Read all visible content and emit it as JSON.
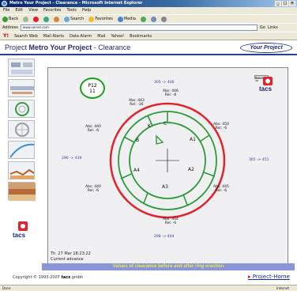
{
  "window": {
    "title": "Metro Your Project - Clearance - Microsoft Internet Explorer"
  },
  "menu": [
    "File",
    "Edit",
    "View",
    "Favorites",
    "Tools",
    "Help"
  ],
  "toolbar": {
    "back": "Back",
    "search": "Search",
    "favorites": "Favorites",
    "media": "Media"
  },
  "address": {
    "label": "Address",
    "value": "www.server.com",
    "go": "Go",
    "links": "Links"
  },
  "linksbar": {
    "logo": "Y!",
    "search_web": "Search Web",
    "items": [
      "Mail Alerts",
      "Data Alarm",
      "Mail",
      "Yahoo!",
      "Bookmarks"
    ]
  },
  "header": {
    "prefix": "Project",
    "project": "Metro Your Project",
    "suffix": "- Clearance",
    "logo": "Your Project"
  },
  "badge": {
    "line1": "P12",
    "line2": "11"
  },
  "tacs": {
    "button": "Back to list",
    "logo": "tacs"
  },
  "sidebar_logo": "tacs",
  "ring": {
    "segments": [
      "C",
      "A1",
      "A2",
      "A3",
      "A4",
      "B",
      "K"
    ],
    "measurements": {
      "top": "305 -> 446",
      "left": "296 -> 439",
      "right": "365 -> 451",
      "bottom": "298 -> 444"
    },
    "readings": [
      {
        "abs": "Abs: 443",
        "rel": "Rel: -16"
      },
      {
        "abs": "Abs: 446",
        "rel": "Rel: -8"
      },
      {
        "abs": "Abs: 450",
        "rel": "Rel: -6"
      },
      {
        "abs": "Abs: 440",
        "rel": "Rel: -6"
      },
      {
        "abs": "Abs: 440",
        "rel": "Rel: -6"
      },
      {
        "abs": "Abs: 445",
        "rel": "Rel: -6"
      },
      {
        "abs": "Abs: 444",
        "rel": "Rel: -6"
      }
    ]
  },
  "info": {
    "datetime": "Th. 27 Mar      18:23:22",
    "status": "Current advance"
  },
  "caption": "Values of clearance before and after ring erection",
  "copyright": {
    "text": "Copyright © 1993-2007",
    "brand": "tacs",
    "suffix": "gmbh"
  },
  "project_home": "Project-Home",
  "status": {
    "left": "Done",
    "zone": "Internet"
  },
  "colors": {
    "ring_red": "#e0242a",
    "ring_green": "#2c9a3a",
    "accent_blue": "#2b3ea0",
    "caption_bg": "#8a96d8",
    "caption_text": "#e8e84a"
  }
}
